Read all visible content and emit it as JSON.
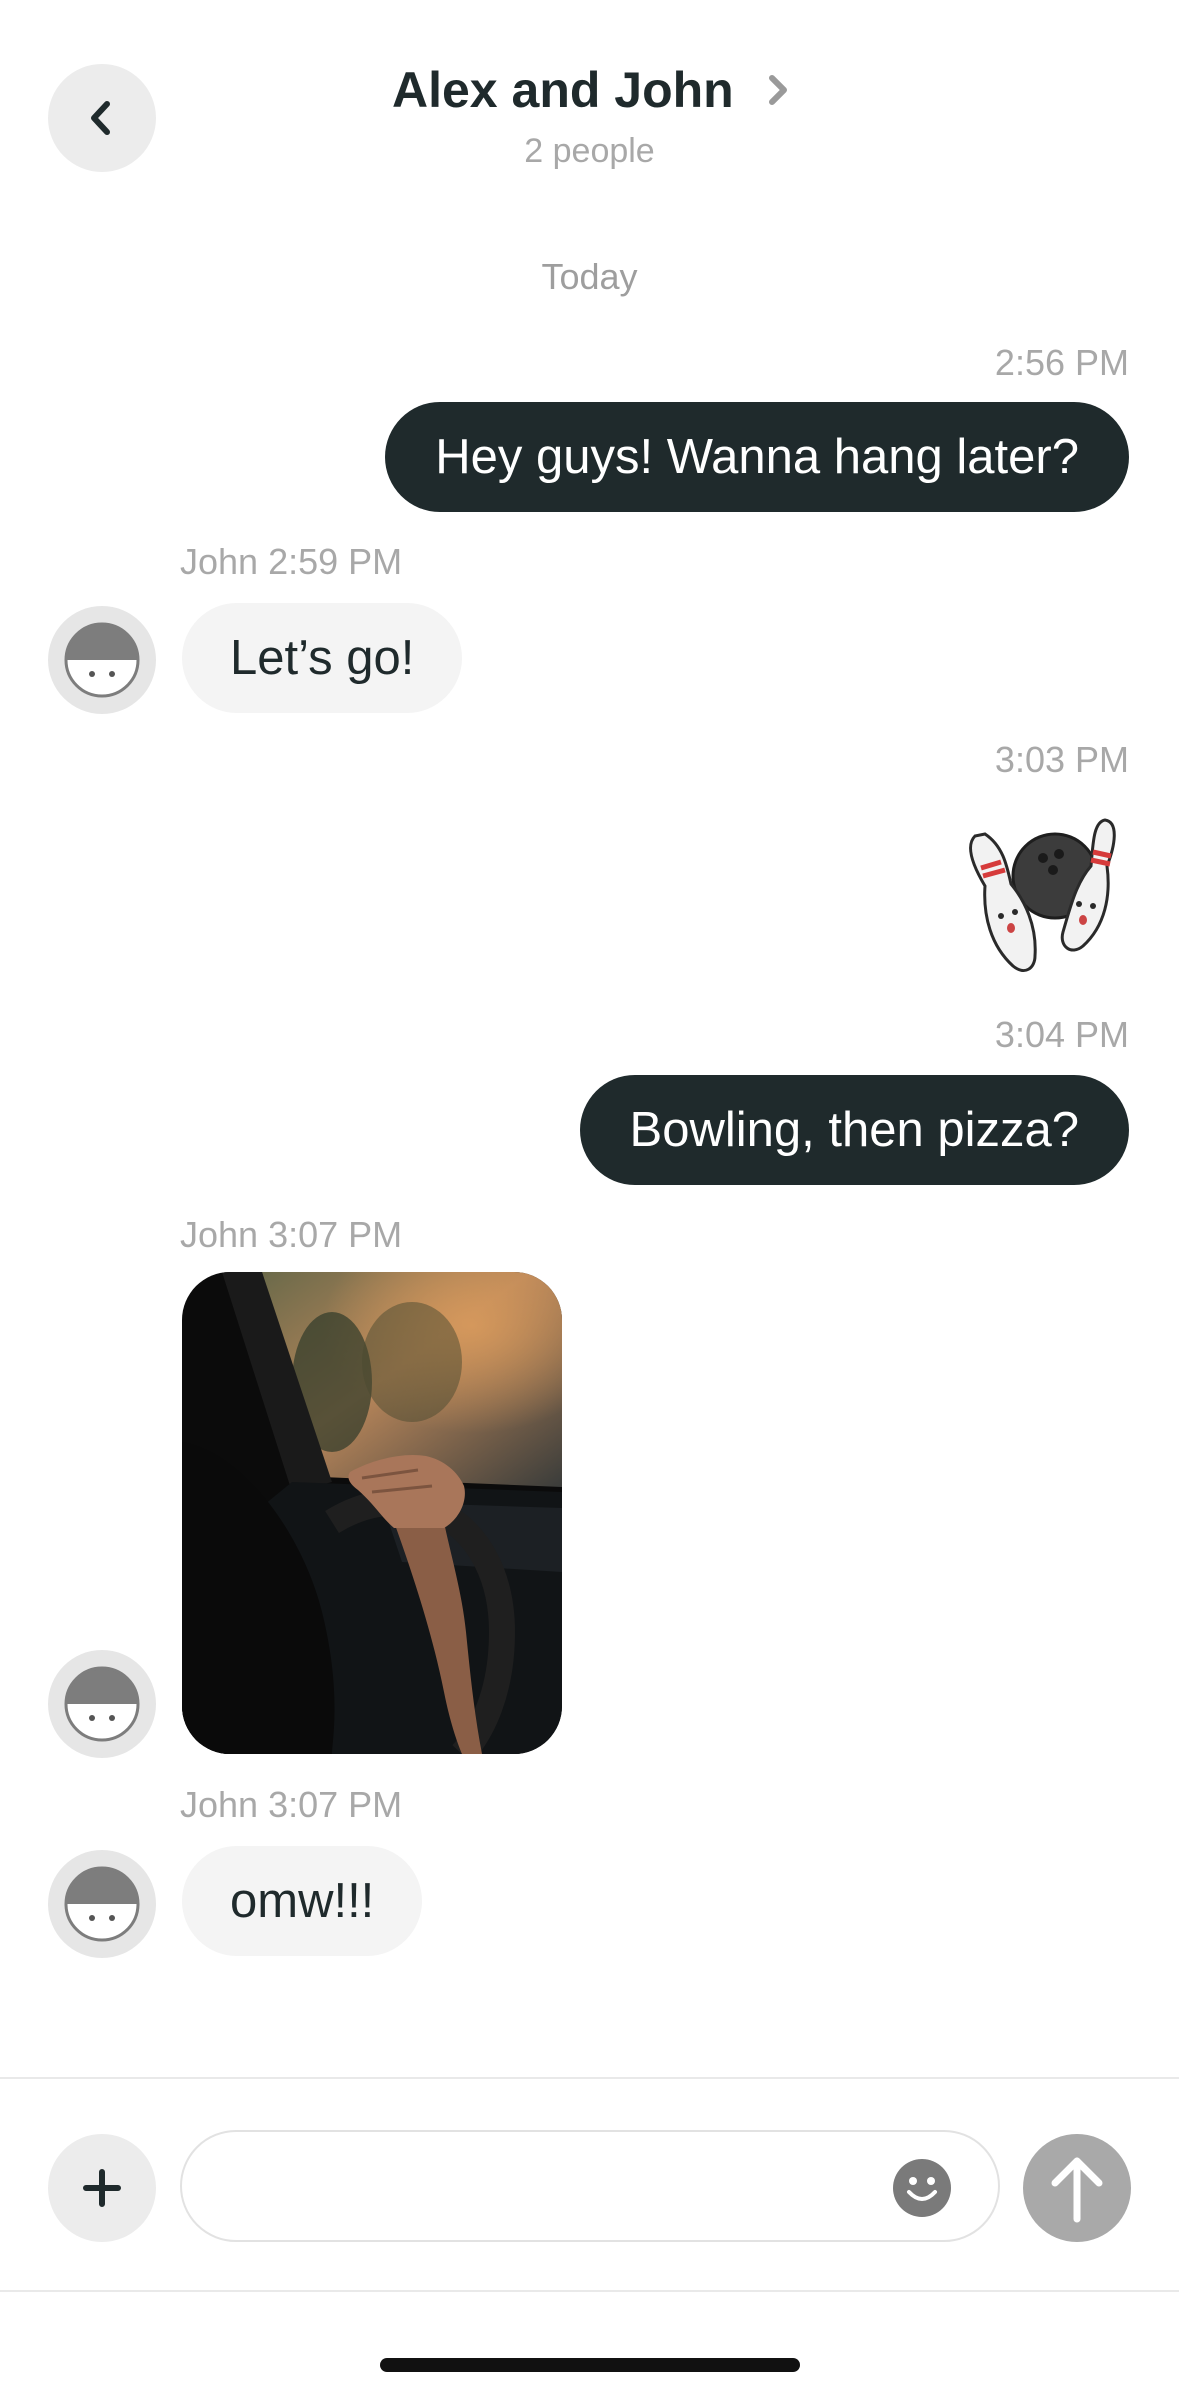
{
  "header": {
    "back_icon": "chevron-left-icon",
    "title": "Alex and John",
    "title_chevron_icon": "chevron-right-icon",
    "subtitle": "2 people"
  },
  "day_label": "Today",
  "messages": [
    {
      "id": "m1",
      "direction": "outgoing",
      "timestamp": "2:56 PM",
      "text": "Hey guys! Wanna hang later?"
    },
    {
      "id": "m2",
      "direction": "incoming",
      "sender": "John",
      "timestamp": "John 2:59 PM",
      "text": "Let’s go!"
    },
    {
      "id": "m3",
      "direction": "outgoing",
      "timestamp": "3:03 PM",
      "sticker": "bowling-sticker"
    },
    {
      "id": "m4",
      "direction": "outgoing",
      "timestamp": "3:04 PM",
      "text": "Bowling, then pizza?"
    },
    {
      "id": "m5",
      "direction": "incoming",
      "sender": "John",
      "timestamp": "John 3:07 PM",
      "image": "driving-photo"
    },
    {
      "id": "m6",
      "direction": "incoming",
      "sender": "John",
      "timestamp": "John 3:07 PM",
      "text": "omw!!!"
    }
  ],
  "composer": {
    "plus_icon": "plus-icon",
    "input_value": "",
    "input_placeholder": "",
    "emoji_icon": "smiley-icon",
    "send_icon": "arrow-up-icon"
  },
  "colors": {
    "outgoing_bubble": "#1f2a2c",
    "incoming_bubble": "#f4f4f4",
    "timestamp": "#a8a8a8",
    "send_button": "#a9a9a9",
    "icon_circle": "#ececec"
  }
}
